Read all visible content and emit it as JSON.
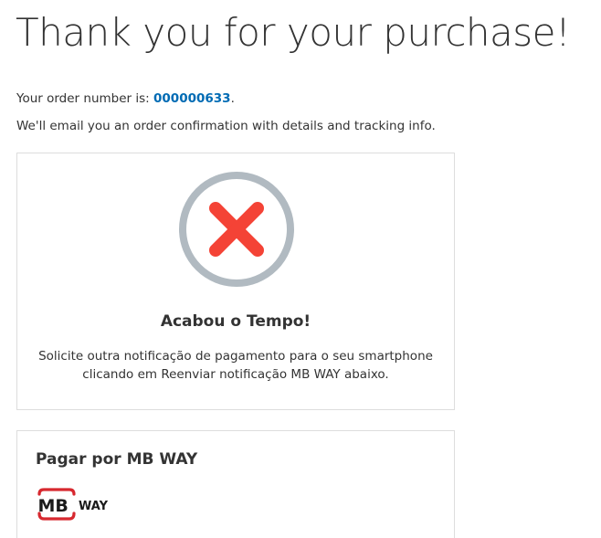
{
  "page": {
    "title": "Thank you for your purchase!"
  },
  "order": {
    "prefix": "Your order number is: ",
    "number": "000000633",
    "suffix": ".",
    "email_message": "We'll email you an order confirmation with details and tracking info."
  },
  "status": {
    "icon": "close-circle-icon",
    "title": "Acabou o Tempo!",
    "message": "Solicite outra notificação de pagamento para o seu smartphone clicando em Reenviar notificação MB WAY abaixo.",
    "colors": {
      "ring": "#b1bac1",
      "cross": "#f44336"
    }
  },
  "payment": {
    "title": "Pagar por MB WAY",
    "logo": {
      "mark": "MB",
      "word": "WAY",
      "color": "#d7282f"
    }
  },
  "colors": {
    "link": "#006bb4",
    "text": "#333333",
    "border": "#dddddd"
  }
}
